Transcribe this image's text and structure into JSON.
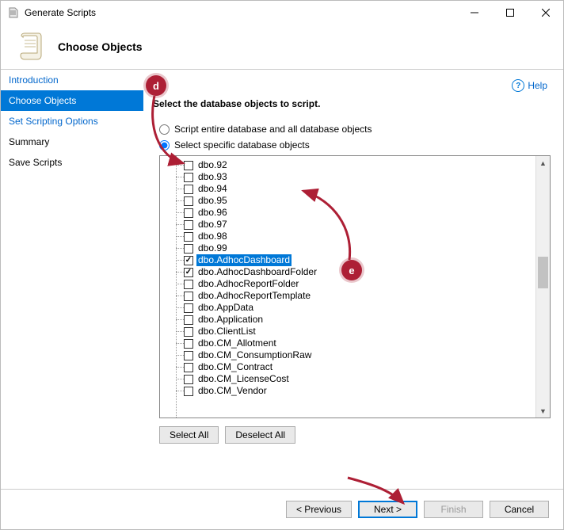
{
  "window": {
    "title": "Generate Scripts"
  },
  "header": {
    "title": "Choose Objects"
  },
  "help": {
    "label": "Help"
  },
  "sidebar": {
    "items": [
      {
        "label": "Introduction",
        "selected": false,
        "link": true
      },
      {
        "label": "Choose Objects",
        "selected": true,
        "link": true
      },
      {
        "label": "Set Scripting Options",
        "selected": false,
        "link": true
      },
      {
        "label": "Summary",
        "selected": false,
        "link": false
      },
      {
        "label": "Save Scripts",
        "selected": false,
        "link": false
      }
    ]
  },
  "main": {
    "instruction": "Select the database objects to script.",
    "radio_all": "Script entire database and all database objects",
    "radio_specific": "Select specific database objects"
  },
  "tree": {
    "items": [
      {
        "label": "dbo.92",
        "checked": false
      },
      {
        "label": "dbo.93",
        "checked": false
      },
      {
        "label": "dbo.94",
        "checked": false
      },
      {
        "label": "dbo.95",
        "checked": false
      },
      {
        "label": "dbo.96",
        "checked": false
      },
      {
        "label": "dbo.97",
        "checked": false
      },
      {
        "label": "dbo.98",
        "checked": false
      },
      {
        "label": "dbo.99",
        "checked": false
      },
      {
        "label": "dbo.AdhocDashboard",
        "checked": true,
        "selected": true
      },
      {
        "label": "dbo.AdhocDashboardFolder",
        "checked": true
      },
      {
        "label": "dbo.AdhocReportFolder",
        "checked": false
      },
      {
        "label": "dbo.AdhocReportTemplate",
        "checked": false
      },
      {
        "label": "dbo.AppData",
        "checked": false
      },
      {
        "label": "dbo.Application",
        "checked": false
      },
      {
        "label": "dbo.ClientList",
        "checked": false
      },
      {
        "label": "dbo.CM_Allotment",
        "checked": false
      },
      {
        "label": "dbo.CM_ConsumptionRaw",
        "checked": false
      },
      {
        "label": "dbo.CM_Contract",
        "checked": false
      },
      {
        "label": "dbo.CM_LicenseCost",
        "checked": false
      },
      {
        "label": "dbo.CM_Vendor",
        "checked": false
      }
    ]
  },
  "buttons": {
    "select_all": "Select All",
    "deselect_all": "Deselect All",
    "previous": "< Previous",
    "next": "Next >",
    "finish": "Finish",
    "cancel": "Cancel"
  },
  "annotations": {
    "d": "d",
    "e": "e"
  }
}
